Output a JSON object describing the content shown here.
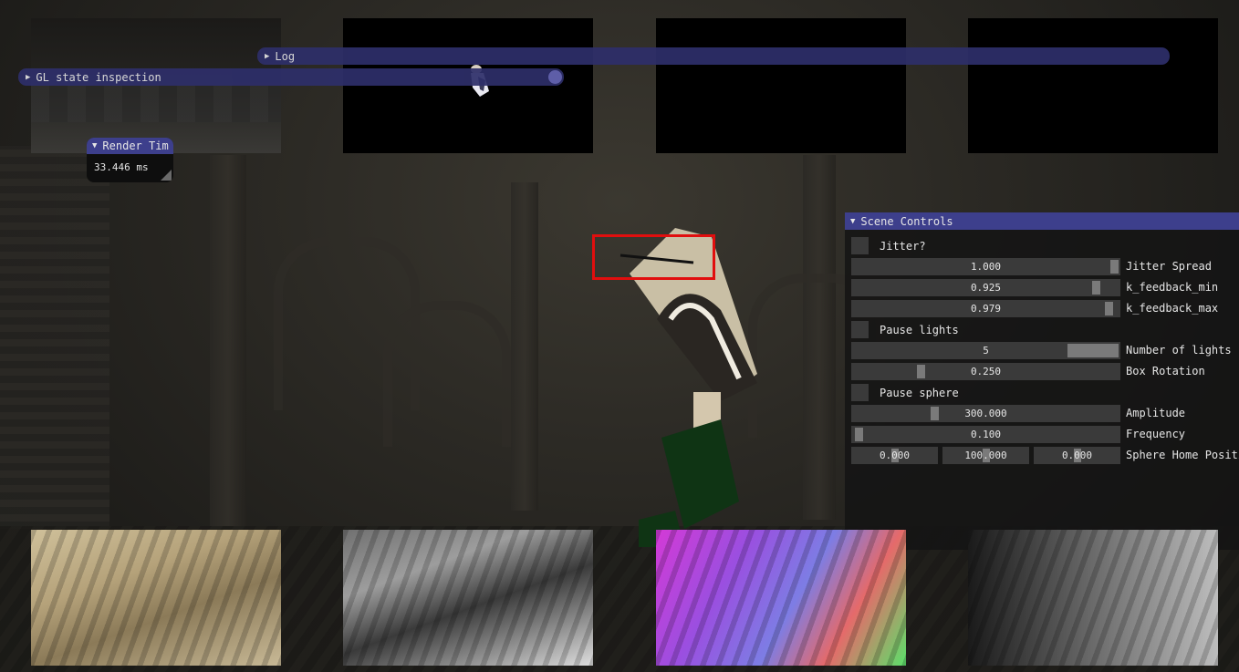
{
  "windows": {
    "log": {
      "title": "Log"
    },
    "gl_state": {
      "title": "GL state inspection"
    },
    "render_time": {
      "title": "Render Tim",
      "value": "33.446 ms"
    },
    "scene_controls": {
      "title": "Scene Controls",
      "jitter": {
        "label": "Jitter?",
        "checked": false
      },
      "jitter_spread": {
        "label": "Jitter Spread",
        "value": "1.000",
        "fraction": 1.0
      },
      "k_feedback_min": {
        "label": "k_feedback_min",
        "value": "0.925",
        "fraction": 0.925
      },
      "k_feedback_max": {
        "label": "k_feedback_max",
        "value": "0.979",
        "fraction": 0.979
      },
      "pause_lights": {
        "label": "Pause lights",
        "checked": false
      },
      "number_of_lights": {
        "label": "Number of lights",
        "value": "5"
      },
      "box_rotation": {
        "label": "Box Rotation",
        "value": "0.250"
      },
      "pause_sphere": {
        "label": "Pause sphere",
        "checked": false
      },
      "amplitude": {
        "label": "Amplitude",
        "value": "300.000"
      },
      "frequency": {
        "label": "Frequency",
        "value": "0.100"
      },
      "sphere_home_position": {
        "label": "Sphere Home Positi",
        "x": "0.000",
        "y": "100.000",
        "z": "0.000"
      }
    }
  },
  "colors": {
    "title_active": "#3d3f8c",
    "title_collapsed": "#2e2f6a",
    "highlight": "#e10e0e",
    "frame_bg": "#3a3a3a",
    "grab": "#7a7a7a"
  },
  "icons": {
    "collapsed_arrow": "▶",
    "expanded_arrow": "▼"
  }
}
